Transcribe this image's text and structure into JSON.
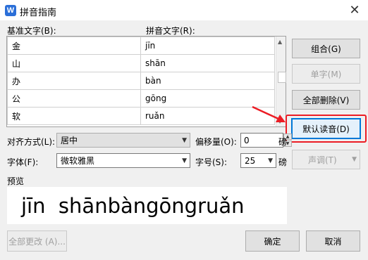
{
  "window": {
    "title": "拼音指南",
    "icon": "W",
    "close": "✕"
  },
  "headers": {
    "base": "基准文字(B):",
    "pinyin": "拼音文字(R):"
  },
  "rows": [
    {
      "base": "金",
      "pinyin": "jīn"
    },
    {
      "base": "山",
      "pinyin": "shān"
    },
    {
      "base": "办",
      "pinyin": "bàn"
    },
    {
      "base": "公",
      "pinyin": "gōng"
    },
    {
      "base": "软",
      "pinyin": "ruǎn"
    }
  ],
  "buttons": {
    "combine": "组合(G)",
    "single": "单字(M)",
    "delete_all": "全部删除(V)",
    "default_reading": "默认读音(D)",
    "tone": "声调(T)",
    "change_all": "全部更改 (A)...",
    "ok": "确定",
    "cancel": "取消"
  },
  "align": {
    "label": "对齐方式(L):",
    "value": "居中"
  },
  "offset": {
    "label": "偏移量(O):",
    "value": "0",
    "unit": "磅"
  },
  "font": {
    "label": "字体(F):",
    "value": "微软雅黑"
  },
  "size": {
    "label": "字号(S):",
    "value": "25",
    "unit": "磅"
  },
  "preview": {
    "label": "预览",
    "text": "jīn  shānbàngōngruǎn"
  },
  "colors": {
    "annotation": "#ec1c24",
    "accent": "#0078d7"
  }
}
